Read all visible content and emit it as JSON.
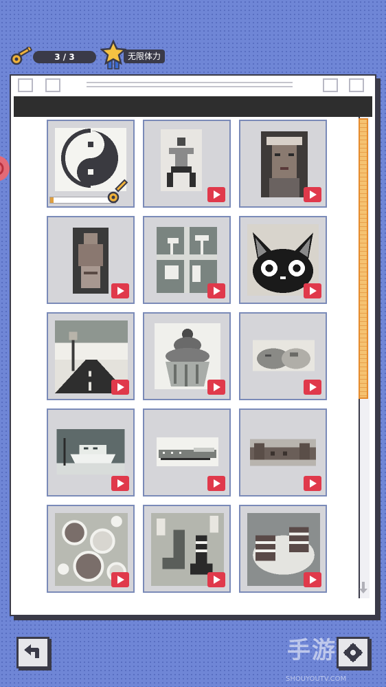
{
  "status": {
    "keys_label": "3 / 3",
    "stamina_label": "无限体力"
  },
  "colors": {
    "background": "#6f86d6",
    "window_border": "#3a3a48",
    "play_badge": "#e0394b",
    "scroll_thumb": "#f5c271",
    "cell_background": "#d5d5d9"
  },
  "puzzles": [
    {
      "subject": "yin-yang",
      "badge": "key-icon",
      "progress": 0.05
    },
    {
      "subject": "martial-artist",
      "badge": "video-play-icon"
    },
    {
      "subject": "opera-mask",
      "badge": "video-play-icon"
    },
    {
      "subject": "stone-monk-statue",
      "badge": "video-play-icon"
    },
    {
      "subject": "window-palm-trees",
      "badge": "video-play-icon"
    },
    {
      "subject": "black-cat",
      "badge": "video-play-icon"
    },
    {
      "subject": "road-highway",
      "badge": "video-play-icon"
    },
    {
      "subject": "cupcake",
      "badge": "video-play-icon"
    },
    {
      "subject": "sleeping-cats",
      "badge": "video-play-icon"
    },
    {
      "subject": "ferry-boat",
      "badge": "video-play-icon"
    },
    {
      "subject": "train",
      "badge": "video-play-icon"
    },
    {
      "subject": "great-wall",
      "badge": "video-play-icon"
    },
    {
      "subject": "lemon-slices",
      "badge": "video-play-icon"
    },
    {
      "subject": "socks",
      "badge": "video-play-icon"
    },
    {
      "subject": "mittens",
      "badge": "video-play-icon"
    }
  ],
  "scroll": {
    "position": 0.0,
    "visible_fraction": 0.58
  },
  "watermark": {
    "text": "手游TV",
    "sub": "SHOUYOUTV.COM"
  }
}
